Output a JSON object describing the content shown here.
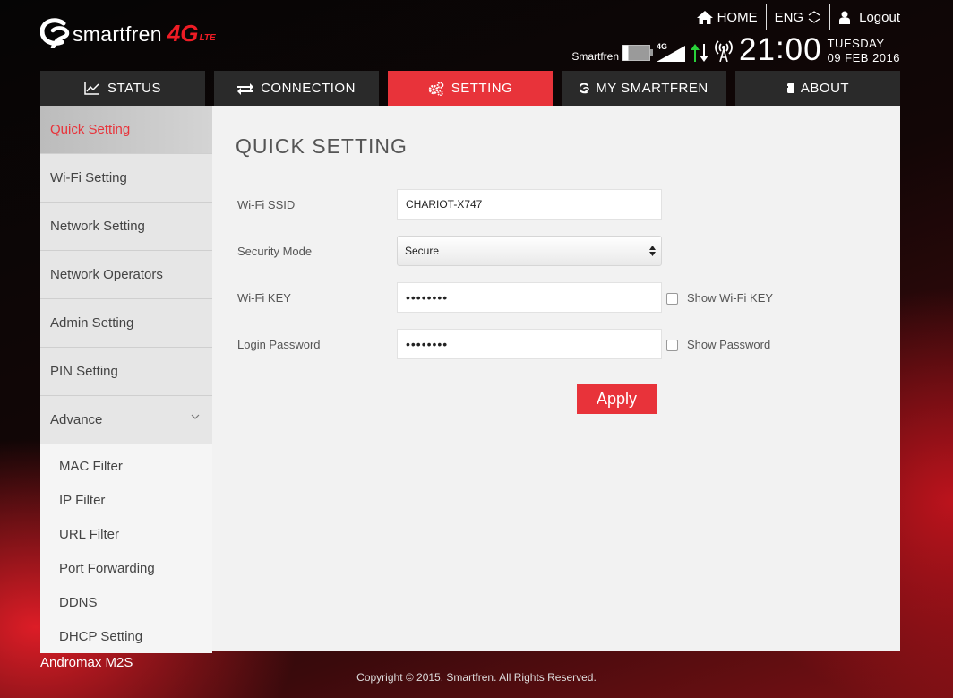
{
  "header": {
    "logo_text": "smartfren",
    "logo_4g": "4G",
    "logo_lte": "LTE",
    "top_links": {
      "home": "HOME",
      "language": "ENG",
      "logout": "Logout"
    }
  },
  "status": {
    "operator": "Smartfren",
    "network_type": "4G",
    "clock_hours": "21",
    "clock_minutes": "00",
    "day": "TUESDAY",
    "date": "09 FEB 2016"
  },
  "tabs": [
    {
      "label": "STATUS",
      "icon": "chart-icon"
    },
    {
      "label": "CONNECTION",
      "icon": "transfer-icon"
    },
    {
      "label": "SETTING",
      "icon": "gears-icon",
      "active": true
    },
    {
      "label": "MY SMARTFREN",
      "icon": "smartfren-icon"
    },
    {
      "label": "ABOUT",
      "icon": "device-icon"
    }
  ],
  "sidebar": {
    "items": [
      {
        "label": "Quick Setting",
        "active": true
      },
      {
        "label": "Wi-Fi Setting"
      },
      {
        "label": "Network Setting"
      },
      {
        "label": "Network Operators"
      },
      {
        "label": "Admin Setting"
      },
      {
        "label": "PIN Setting"
      },
      {
        "label": "Advance",
        "expanded": true
      }
    ],
    "sub_items": [
      {
        "label": "MAC Filter"
      },
      {
        "label": "IP Filter"
      },
      {
        "label": "URL Filter"
      },
      {
        "label": "Port Forwarding"
      },
      {
        "label": "DDNS"
      },
      {
        "label": "DHCP Setting"
      }
    ]
  },
  "main": {
    "title": "QUICK SETTING",
    "form": {
      "ssid_label": "Wi-Fi SSID",
      "ssid_value": "CHARIOT-X747",
      "security_label": "Security Mode",
      "security_value": "Secure",
      "wifi_key_label": "Wi-Fi KEY",
      "wifi_key_value": "••••••••",
      "show_wifi_key_label": "Show Wi-Fi KEY",
      "login_password_label": "Login Password",
      "login_password_value": "••••••••",
      "show_password_label": "Show Password"
    },
    "apply_label": "Apply"
  },
  "footer": {
    "model": "Andromax M2S",
    "copyright": "Copyright © 2015. Smartfren. All Rights Reserved."
  },
  "colors": {
    "accent": "#e8333a",
    "tab_bg": "#2a2a2a",
    "panel_bg": "#f2f2f2"
  }
}
